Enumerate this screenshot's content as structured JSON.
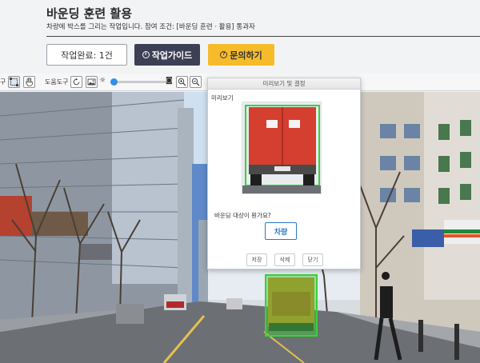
{
  "header": {
    "title": "바운딩 훈련 활용",
    "subtitle": "차량에 박스를 그리는 작업입니다. 참여 조건: [바운딩 훈련 · 활용] 통과자",
    "done_button": "작업완료: 1건",
    "guide_button": "작업가이드",
    "ask_button": "문의하기"
  },
  "toolbar": {
    "left_cut_label": "구",
    "tools_label": "도움도구"
  },
  "dialog": {
    "title": "미리보기 및 결정",
    "preview_label": "미리보기",
    "question": "바운딩 대상이 뭔가요?",
    "category_button": "차량",
    "save_button": "저장",
    "delete_button": "삭제",
    "close_button": "닫기"
  },
  "colors": {
    "guide_button_bg": "#3c4055",
    "ask_button_bg": "#f6bb2a",
    "category_accent": "#2b79c9",
    "bbox_green": "#39d13a",
    "slider_knob": "#2f8fe6"
  },
  "icons": {
    "select_tool": "box-select-icon",
    "pan_tool": "hand-icon",
    "reset": "rotate-icon",
    "image": "image-icon",
    "brightness": "brightness-icon",
    "zoom_in": "zoom-in-icon",
    "zoom_out": "zoom-out-icon",
    "guide": "info-icon",
    "ask": "question-icon"
  },
  "slider": {
    "value_fraction": 0.05
  }
}
